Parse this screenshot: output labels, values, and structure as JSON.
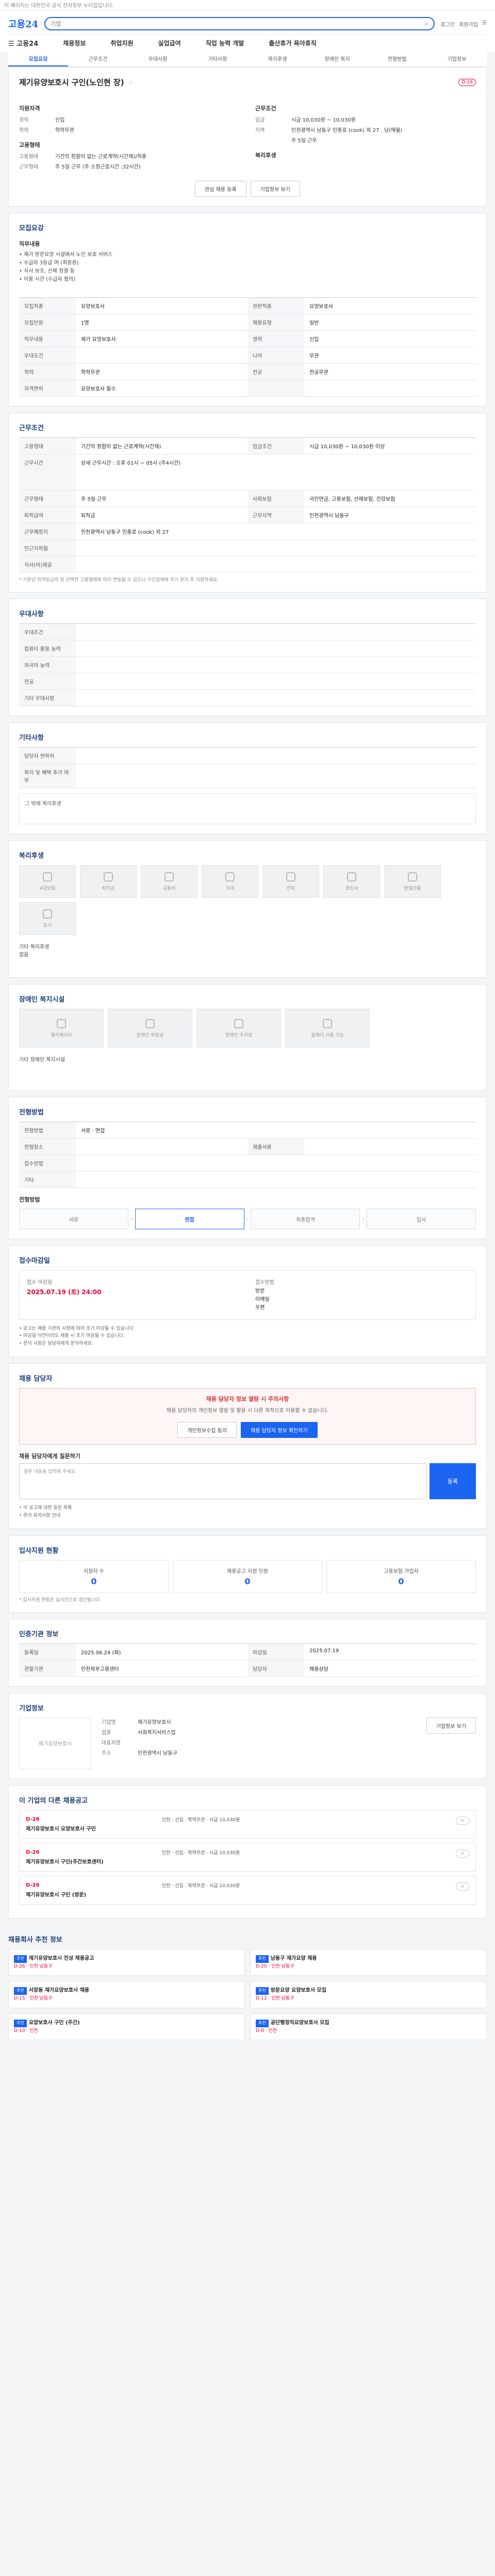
{
  "topbar": {
    "text": "이 페이지는 대한민국 공식 전자정부 누리집입니다."
  },
  "header": {
    "logo": "고용24",
    "search_placeholder": "기업",
    "right_links": [
      "로그인",
      "회원가입",
      "☰"
    ],
    "gnb_all": "☰ 고용24",
    "gnb": [
      "채용정보",
      "취업지원",
      "실업급여",
      "직업 능력 개발",
      "출산휴가 육아휴직"
    ]
  },
  "tabs": [
    "모집요강",
    "근무조건",
    "우대사항",
    "기타사항",
    "복리후생",
    "장애인 복지",
    "전형방법",
    "기업정보"
  ],
  "job": {
    "title": "제기유양보호시 구인(노인현 장)",
    "dday": "D-26",
    "left_h": "지원자격",
    "left_rows": [
      [
        "경력",
        "신입"
      ],
      [
        "학력",
        "학력무관"
      ]
    ],
    "right_h": "근무조건",
    "right_rows": [
      [
        "임금",
        "시급 10,030원 ~ 10,030원"
      ],
      [
        "지역",
        "인천광역시 남동구 인종로 (cook) 외 27 , 남(매월)"
      ],
      [
        "",
        "주 5일 근무"
      ]
    ],
    "emp_h": "고용형태",
    "emp_rows": [
      [
        "고용형태",
        "기간의 정함이 없는 근로계약(시간제)/직종"
      ],
      [
        "근무형태",
        "주 5일 근무 (주 소정근로시간 :32시간)"
      ]
    ],
    "welfare_h": "복리후생",
    "btn_apply": "관심 채용 등록",
    "btn_share": "기업정보 보기"
  },
  "recruit": {
    "h": "모집요강",
    "duty_title": "직무내용",
    "duty": "• 재가 방문요양 시설에서 노인 보호 서비스\n• 수급자 3등급 여 (최중증)\n• 식사 보조, 신체 청결 등\n• 이용 시간 (수급자 협의)",
    "rows": [
      [
        "모집직종",
        "요양보호사",
        "관련직종",
        "요양보호사"
      ],
      [
        "모집인원",
        "1명",
        "채용유형",
        "일반"
      ],
      [
        "직무내용",
        "재가 요양보호사",
        "경력",
        "신입"
      ],
      [
        "우대조건",
        "",
        "나이",
        "무관"
      ],
      [
        "학력",
        "학력무관",
        "전공",
        "전공무관"
      ],
      [
        "자격면허",
        "요양보호사 필수",
        "",
        ""
      ]
    ]
  },
  "work": {
    "h": "근무조건",
    "rows": [
      [
        "고용형태",
        "기간의 정함이 없는 근로계약(시간제)",
        "임금조건",
        "시급 10,030원 ~ 10,030원 이상"
      ],
      [
        "근무시간",
        "상세 근무시간 : 오후 01시 ~ 05시 (주4시간)",
        "",
        ""
      ],
      [
        "근무형태",
        "주 5일 근무",
        "사회보험",
        "국민연금, 고용보험, 산재보험, 건강보험"
      ],
      [
        "퇴직급여",
        "퇴직금",
        "근무지역",
        "인천광역시 남동구"
      ],
      [
        "근무예정지",
        "인천광역시 남동구 인종로 (cook) 외 27",
        "",
        ""
      ],
      [
        "인근지하철",
        "",
        "",
        ""
      ],
      [
        "식사(비)제공",
        "",
        "",
        ""
      ]
    ],
    "note": "* 기준년 최저임금의 및 선택한 고용형태에 따라 변동될 수 있으니 구인업체에 추가 문의 후 지원하세요."
  },
  "pref": {
    "h": "우대사항",
    "rows": [
      [
        "우대조건",
        ""
      ],
      [
        "컴퓨터 활용 능력",
        ""
      ],
      [
        "외국어 능력",
        ""
      ],
      [
        "전공",
        ""
      ],
      [
        "기타 우대사항",
        ""
      ]
    ]
  },
  "etc": {
    "h": "기타사항",
    "rows": [
      [
        "담당자 연락처",
        ""
      ],
      [
        "복지 및 혜택 추가 여부",
        ""
      ]
    ],
    "extra": "그 밖에 복리후생"
  },
  "welfare": {
    "h": "복리후생",
    "items": [
      "4대보험",
      "퇴직금",
      "교통비",
      "식대",
      "연차",
      "경조사",
      "명절선물",
      "휴가"
    ],
    "note": "기타 복리후생\n없음"
  },
  "disab": {
    "h": "장애인 복지시설",
    "items": [
      "엘리베이터",
      "장애인 화장실",
      "장애인 주차장",
      "휠체어 사용 가능"
    ],
    "note": "기타 장애인 복지시설"
  },
  "select": {
    "h": "전형방법",
    "rows": [
      [
        "전형방법",
        "서류 · 면접"
      ],
      [
        "전형장소",
        "",
        "제출서류",
        ""
      ],
      [
        "접수방법",
        "",
        "",
        ""
      ],
      [
        "기타",
        "",
        "",
        ""
      ]
    ],
    "steps": [
      "서류",
      "면접",
      "최종합격",
      "입사"
    ]
  },
  "apply": {
    "h": "접수마감일",
    "deadline_label": "접수 마감일",
    "deadline": "2025.07.19 (토) 24:00",
    "method_label": "접수방법",
    "method": "방문\n이메일\n우편",
    "info": "• 공고는 채용 기관의 사정에 따라 조기 마감될 수 있습니다.\n• 마감일 이전이라도 채용 시 조기 마감될 수 있습니다.\n• 문의 사항은 담당자에게 문의하세요."
  },
  "inquiry": {
    "h": "채용 담당자",
    "alert": "채용 담당자 정보 열람 시 주의사항",
    "alert_desc": "채용 담당자의 개인정보 열람 및 활용 시 다른 목적으로 이용할 수 없습니다.",
    "btn1": "개인정보수집 동의",
    "btn2": "채용 담당자 정보 확인하기"
  },
  "qna": {
    "h": "채용 담당자에게 질문하기",
    "placeholder": "질문 내용을 입력해 주세요.",
    "btn": "등록",
    "links": [
      "• 이 공고에 대한 질문 목록",
      "• 문의 유의사항 안내"
    ]
  },
  "process": {
    "h": "입사지원 현황",
    "items": [
      [
        "지원자 수",
        "0"
      ],
      [
        "채용공고 지원 인원",
        "0"
      ],
      [
        "고용보험 가입자",
        "0"
      ]
    ],
    "note": "* 입사지원 현황은 실시간으로 갱신됩니다."
  },
  "source": {
    "h": "인증기관 정보",
    "rows": [
      [
        "등록일",
        "2025.06.24 (화)",
        "마감일",
        "2025.07.19"
      ],
      [
        "관할기관",
        "인천북부고용센터",
        "담당자",
        "채용상담"
      ]
    ]
  },
  "company": {
    "h": "기업정보",
    "name": "제기유양보호시",
    "rows": [
      [
        "기업명",
        "제기유양보호시"
      ],
      [
        "업종",
        "사회복지서비스업"
      ],
      [
        "대표자명",
        ""
      ],
      [
        "주소",
        "인천광역시 남동구"
      ]
    ],
    "btn": "기업정보 보기"
  },
  "other": {
    "h": "이 기업의 다른 채용공고",
    "items": [
      {
        "dday": "D-26",
        "title": "제기유양보호시 요양보호사 구인",
        "meta": "인천 · 신입 · 학력무관 · 시급 10,030원"
      },
      {
        "dday": "D-26",
        "title": "제기유양보호시 구인(주간보호센터)",
        "meta": "인천 · 신입 · 학력무관 · 시급 10,030원"
      },
      {
        "dday": "D-26",
        "title": "제기유양보호시 구인 (방문)",
        "meta": "인천 · 신입 · 학력무관 · 시급 10,030원"
      }
    ]
  },
  "recs": {
    "h": "채용회사 추천 정보",
    "items": [
      {
        "tag": "추천",
        "title": "제기유양보호시 전성 채용공고",
        "dd": "D-26 · 인천 남동구"
      },
      {
        "tag": "추천",
        "title": "남동구 재가요양 채용",
        "dd": "D-20 · 인천 남동구"
      },
      {
        "tag": "추천",
        "title": "서창동 재가요양보호사 채용",
        "dd": "D-15 · 인천 남동구"
      },
      {
        "tag": "추천",
        "title": "방문요양 요양보호사 모집",
        "dd": "D-12 · 인천 남동구"
      },
      {
        "tag": "추천",
        "title": "요양보호사 구인 (주간)",
        "dd": "D-10 · 인천"
      },
      {
        "tag": "추천",
        "title": "공단행정직요양보호사 모집",
        "dd": "D-8 · 인천"
      }
    ]
  }
}
